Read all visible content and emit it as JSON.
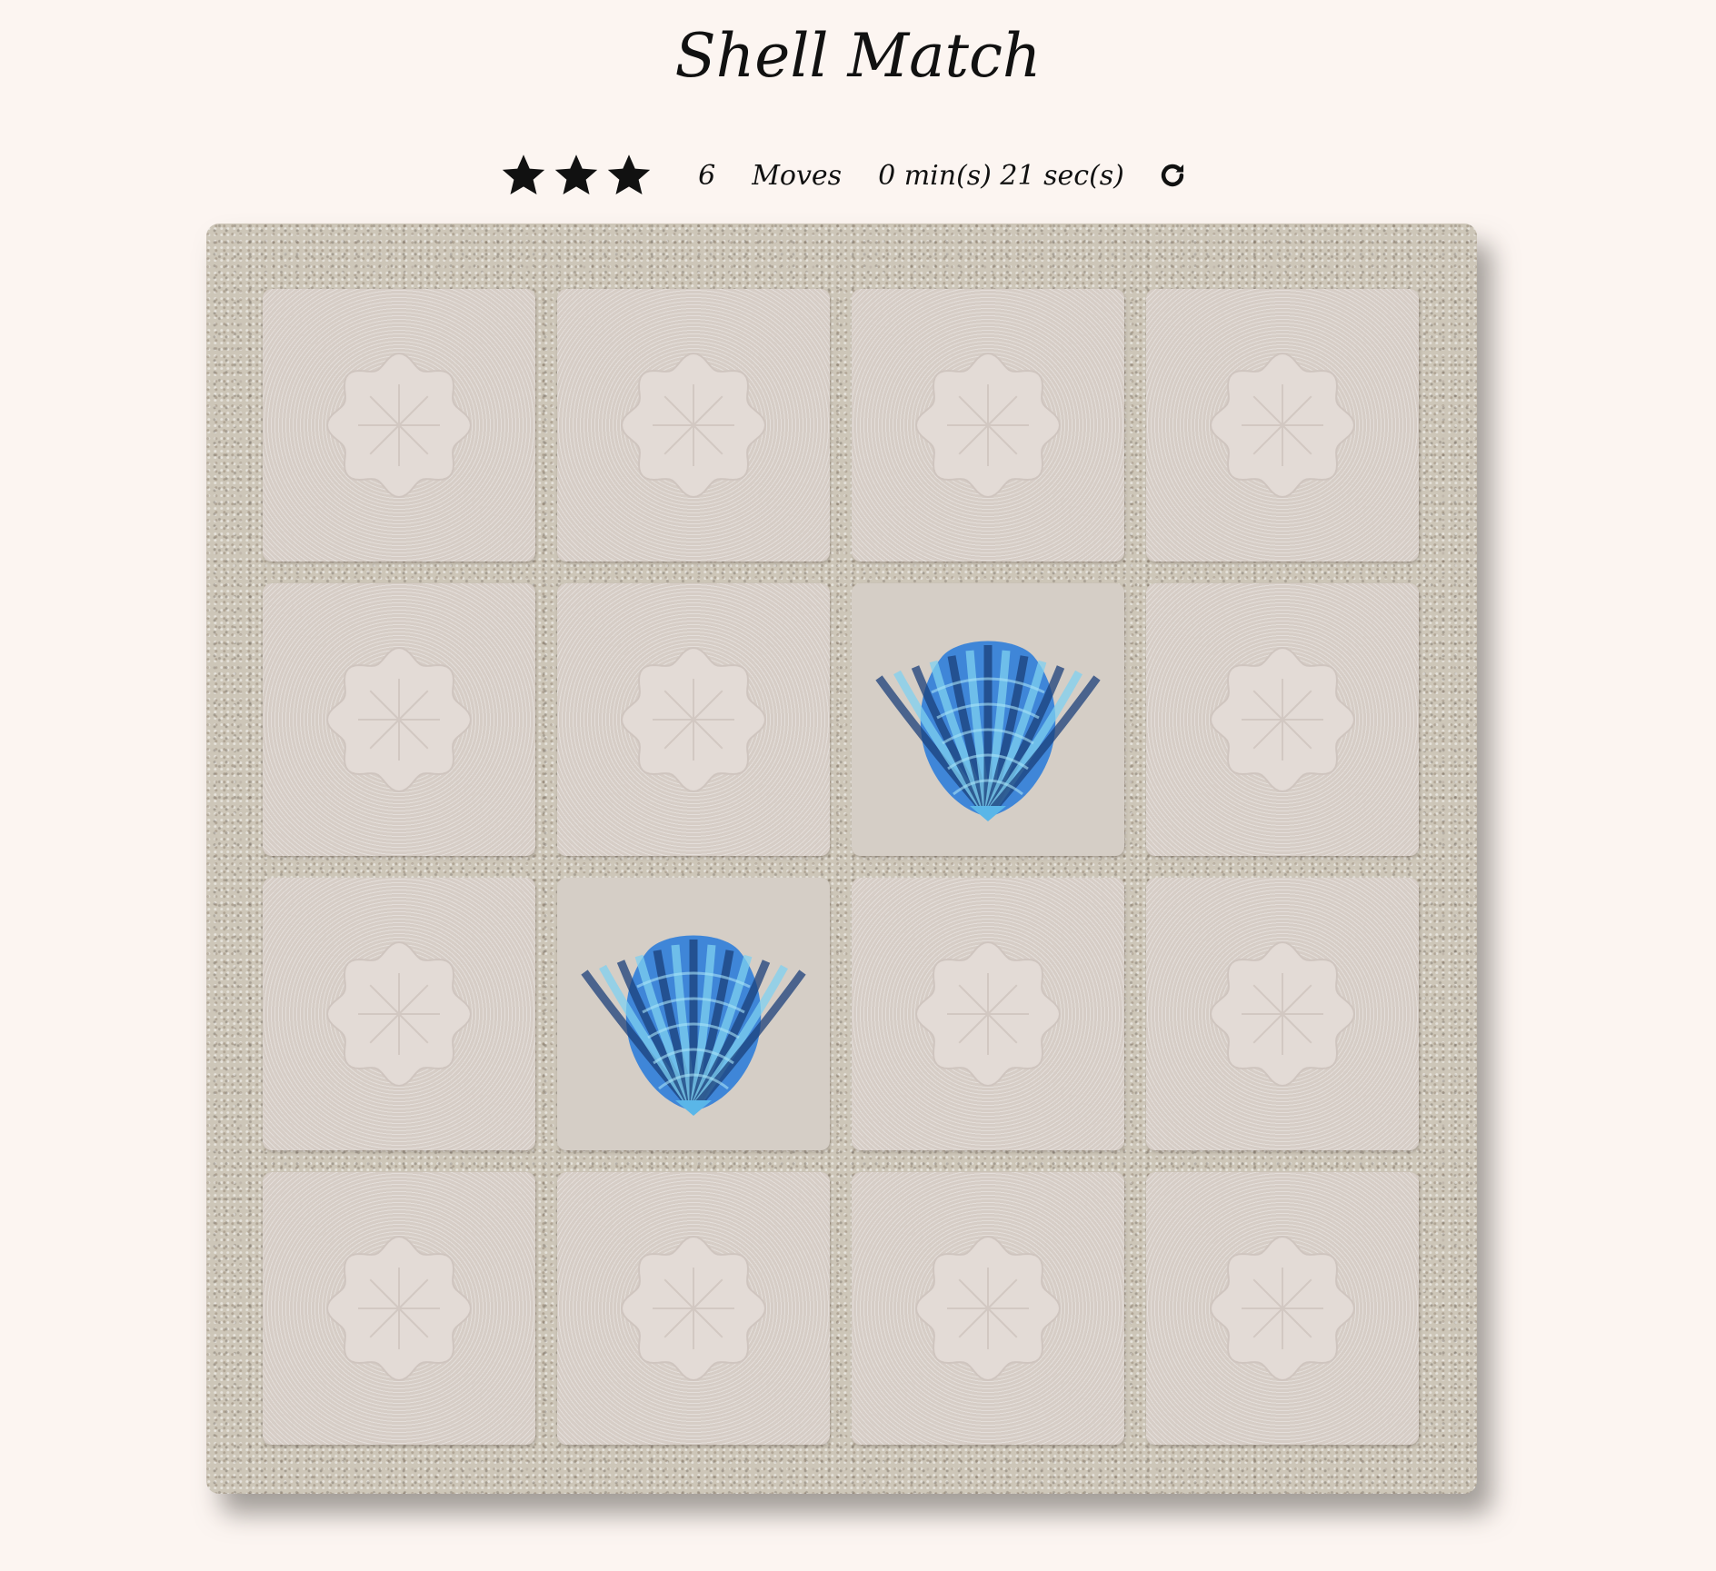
{
  "title": "Shell Match",
  "score_panel": {
    "stars": 3,
    "moves_count": "6",
    "moves_label": "Moves",
    "timer": "0 min(s) 21 sec(s)"
  },
  "deck": {
    "rows": 4,
    "cols": 4,
    "cards": [
      {
        "state": "hidden"
      },
      {
        "state": "hidden"
      },
      {
        "state": "hidden"
      },
      {
        "state": "hidden"
      },
      {
        "state": "hidden"
      },
      {
        "state": "hidden"
      },
      {
        "state": "open",
        "symbol": "blue-scallop-shell"
      },
      {
        "state": "hidden"
      },
      {
        "state": "hidden"
      },
      {
        "state": "open",
        "symbol": "blue-scallop-shell"
      },
      {
        "state": "hidden"
      },
      {
        "state": "hidden"
      },
      {
        "state": "hidden"
      },
      {
        "state": "hidden"
      },
      {
        "state": "hidden"
      },
      {
        "state": "hidden"
      }
    ]
  },
  "colors": {
    "background": "#fcf5f1",
    "card_back": "#d6cdc6",
    "shell_blue": "#3f86d8"
  }
}
